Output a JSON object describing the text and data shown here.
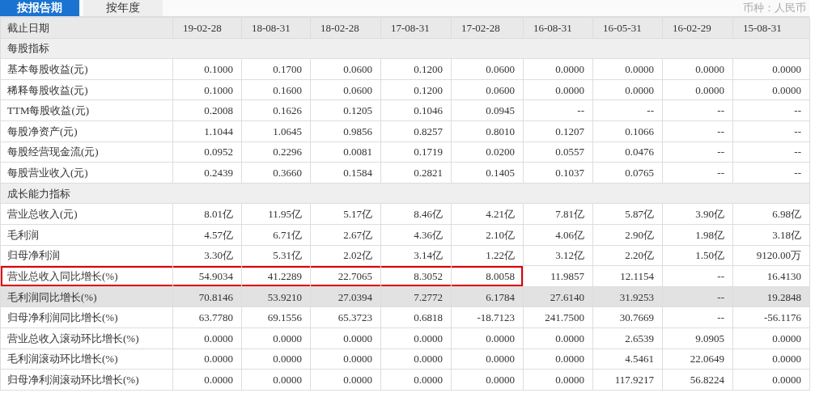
{
  "tabs": [
    {
      "label": "按报告期",
      "selected": true
    },
    {
      "label": "按年度",
      "selected": false
    }
  ],
  "currency": "币种：人民币",
  "table": {
    "columns": [
      "截止日期",
      "19-02-28",
      "18-08-31",
      "18-02-28",
      "17-08-31",
      "17-02-28",
      "16-08-31",
      "16-05-31",
      "16-02-29",
      "15-08-31"
    ],
    "rows": [
      {
        "kind": "section",
        "label": "每股指标"
      },
      {
        "kind": "data",
        "selected": false,
        "label": "基本每股收益(元)",
        "values": [
          "0.1000",
          "0.1700",
          "0.0600",
          "0.1200",
          "0.0600",
          "0.0000",
          "0.0000",
          "0.0000",
          "0.0000"
        ]
      },
      {
        "kind": "data",
        "selected": false,
        "label": "稀释每股收益(元)",
        "values": [
          "0.1000",
          "0.1600",
          "0.0600",
          "0.1200",
          "0.0600",
          "0.0000",
          "0.0000",
          "0.0000",
          "0.0000"
        ]
      },
      {
        "kind": "data",
        "selected": false,
        "label": "TTM每股收益(元)",
        "values": [
          "0.2008",
          "0.1626",
          "0.1205",
          "0.1046",
          "0.0945",
          "--",
          "--",
          "--",
          "--"
        ]
      },
      {
        "kind": "data",
        "selected": false,
        "label": "每股净资产(元)",
        "values": [
          "1.1044",
          "1.0645",
          "0.9856",
          "0.8257",
          "0.8010",
          "0.1207",
          "0.1066",
          "--",
          "--"
        ]
      },
      {
        "kind": "data",
        "selected": false,
        "label": "每股经营现金流(元)",
        "values": [
          "0.0952",
          "0.2296",
          "0.0081",
          "0.1719",
          "0.0200",
          "0.0557",
          "0.0476",
          "--",
          "--"
        ]
      },
      {
        "kind": "data",
        "selected": false,
        "label": "每股营业收入(元)",
        "values": [
          "0.2439",
          "0.3660",
          "0.1584",
          "0.2821",
          "0.1405",
          "0.1037",
          "0.0765",
          "--",
          "--"
        ]
      },
      {
        "kind": "section",
        "label": "成长能力指标"
      },
      {
        "kind": "data",
        "selected": false,
        "label": "营业总收入(元)",
        "values": [
          "8.01亿",
          "11.95亿",
          "5.17亿",
          "8.46亿",
          "4.21亿",
          "7.81亿",
          "5.87亿",
          "3.90亿",
          "6.98亿"
        ]
      },
      {
        "kind": "data",
        "selected": false,
        "label": "毛利润",
        "values": [
          "4.57亿",
          "6.71亿",
          "2.67亿",
          "4.36亿",
          "2.10亿",
          "4.06亿",
          "2.90亿",
          "1.98亿",
          "3.18亿"
        ]
      },
      {
        "kind": "data",
        "selected": false,
        "label": "归母净利润",
        "values": [
          "3.30亿",
          "5.31亿",
          "2.02亿",
          "3.14亿",
          "1.22亿",
          "3.12亿",
          "2.20亿",
          "1.50亿",
          "9120.00万"
        ]
      },
      {
        "kind": "data",
        "selected": false,
        "label": "营业总收入同比增长(%)",
        "values": [
          "54.9034",
          "41.2289",
          "22.7065",
          "8.3052",
          "8.0058",
          "11.9857",
          "12.1154",
          "--",
          "16.4130"
        ],
        "outline": [
          true,
          true,
          true,
          true,
          true,
          false,
          false,
          false,
          false
        ]
      },
      {
        "kind": "data",
        "selected": true,
        "label": "毛利润同比增长(%)",
        "values": [
          "70.8146",
          "53.9210",
          "27.0394",
          "7.2772",
          "6.1784",
          "27.6140",
          "31.9253",
          "--",
          "19.2848"
        ]
      },
      {
        "kind": "data",
        "selected": false,
        "label": "归母净利润同比增长(%)",
        "values": [
          "63.7780",
          "69.1556",
          "65.3723",
          "0.6818",
          "-18.7123",
          "241.7500",
          "30.7669",
          "--",
          "-56.1176"
        ]
      },
      {
        "kind": "data",
        "selected": false,
        "label": "营业总收入滚动环比增长(%)",
        "values": [
          "0.0000",
          "0.0000",
          "0.0000",
          "0.0000",
          "0.0000",
          "0.0000",
          "2.6539",
          "9.0905",
          "0.0000"
        ]
      },
      {
        "kind": "data",
        "selected": false,
        "label": "毛利润滚动环比增长(%)",
        "values": [
          "0.0000",
          "0.0000",
          "0.0000",
          "0.0000",
          "0.0000",
          "0.0000",
          "4.5461",
          "22.0649",
          "0.0000"
        ]
      },
      {
        "kind": "data",
        "selected": false,
        "label": "归母净利润滚动环比增长(%)",
        "values": [
          "0.0000",
          "0.0000",
          "0.0000",
          "0.0000",
          "0.0000",
          "0.0000",
          "117.9217",
          "56.8224",
          "0.0000"
        ]
      }
    ]
  }
}
